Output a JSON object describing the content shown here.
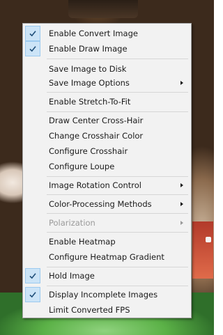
{
  "menu": {
    "items": [
      {
        "label": "Enable Convert Image",
        "checked": true
      },
      {
        "label": "Enable Draw Image",
        "checked": true
      },
      {
        "label": "Save Image to Disk"
      },
      {
        "label": "Save Image Options",
        "submenu": true
      },
      {
        "label": "Enable Stretch-To-Fit"
      },
      {
        "label": "Draw Center Cross-Hair"
      },
      {
        "label": "Change Crosshair Color"
      },
      {
        "label": "Configure Crosshair"
      },
      {
        "label": "Configure Loupe"
      },
      {
        "label": "Image Rotation Control",
        "submenu": true
      },
      {
        "label": "Color-Processing Methods",
        "submenu": true
      },
      {
        "label": "Polarization",
        "submenu": true,
        "disabled": true
      },
      {
        "label": "Enable Heatmap"
      },
      {
        "label": "Configure Heatmap Gradient"
      },
      {
        "label": "Hold Image",
        "checked": true
      },
      {
        "label": "Display Incomplete Images",
        "checked": true
      },
      {
        "label": "Limit Converted FPS"
      }
    ],
    "icons": {
      "check": "checkmark-icon",
      "submenu": "chevron-right-icon"
    },
    "colors": {
      "check_bg": "#cce4f7",
      "check_border": "#9ccaef",
      "check_mark": "#1f4e79",
      "menu_bg": "#f2f2f2",
      "disabled_text": "#9a9a9a"
    }
  }
}
